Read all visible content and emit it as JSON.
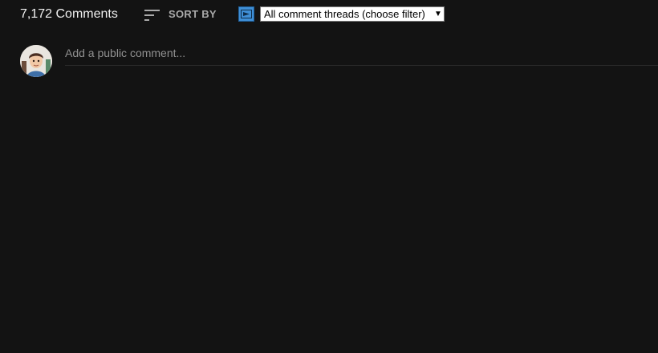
{
  "comments": {
    "count_label": "7,172 Comments",
    "sort_label": "SORT BY",
    "sort_icon": "sort-lines-icon"
  },
  "filter": {
    "extension_icon": "extension-icon",
    "selected": "All comment threads (choose filter)",
    "arrow": "▼"
  },
  "composer": {
    "placeholder": "Add a public comment...",
    "avatar": "user-avatar"
  },
  "colors": {
    "background": "#131313",
    "primary_text": "#f1f1f1",
    "secondary_text": "#aaaaaa",
    "placeholder_text": "#909090",
    "extension_icon_bg": "#3f8fd6"
  }
}
